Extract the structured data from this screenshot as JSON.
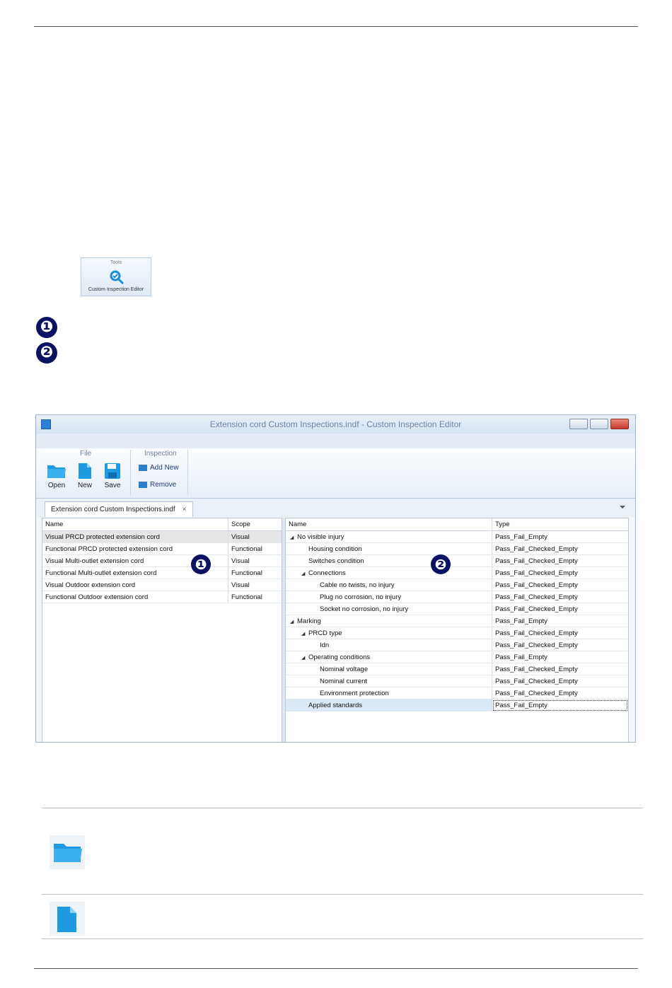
{
  "tools_button": {
    "group_label": "Tools",
    "label": "Custom Inspection Editor"
  },
  "markers": [
    "❶",
    "❷"
  ],
  "window": {
    "title": "Extension cord Custom Inspections.indf - Custom Inspection Editor",
    "ribbon": {
      "file_group": "File",
      "inspection_group": "Inspection",
      "open": "Open",
      "new": "New",
      "save": "Save",
      "add_new": "Add New",
      "remove": "Remove"
    },
    "doc_tab": "Extension cord Custom Inspections.indf",
    "doc_tab_close": "×"
  },
  "left_table": {
    "headers": [
      "Name",
      "Scope"
    ],
    "rows": [
      {
        "name": "Visual PRCD protected extension cord",
        "scope": "Visual"
      },
      {
        "name": "Functional PRCD protected extension cord",
        "scope": "Functional"
      },
      {
        "name": "Visual Multi-outlet extension cord",
        "scope": "Visual"
      },
      {
        "name": "Functional Multi-outlet extension cord",
        "scope": "Functional"
      },
      {
        "name": "Visual Outdoor extension cord",
        "scope": "Visual"
      },
      {
        "name": "Functional Outdoor extension cord",
        "scope": "Functional"
      }
    ]
  },
  "right_table": {
    "headers": [
      "Name",
      "Type"
    ],
    "rows": [
      {
        "name": "No visible injury",
        "type": "Pass_Fail_Empty",
        "level": 0,
        "expander": "◢"
      },
      {
        "name": "Housing condition",
        "type": "Pass_Fail_Checked_Empty",
        "level": 1,
        "expander": ""
      },
      {
        "name": "Switches condition",
        "type": "Pass_Fail_Checked_Empty",
        "level": 1,
        "expander": ""
      },
      {
        "name": "Connections",
        "type": "Pass_Fail_Checked_Empty",
        "level": 1,
        "expander": "◢"
      },
      {
        "name": "Cable no twists, no injury",
        "type": "Pass_Fail_Checked_Empty",
        "level": 2,
        "expander": ""
      },
      {
        "name": "Plug no corrosion, no injury",
        "type": "Pass_Fail_Checked_Empty",
        "level": 2,
        "expander": ""
      },
      {
        "name": "Socket no corrosion, no injury",
        "type": "Pass_Fail_Checked_Empty",
        "level": 2,
        "expander": ""
      },
      {
        "name": "Marking",
        "type": "Pass_Fail_Empty",
        "level": 0,
        "expander": "◢"
      },
      {
        "name": "PRCD type",
        "type": "Pass_Fail_Checked_Empty",
        "level": 1,
        "expander": "◢"
      },
      {
        "name": "Idn",
        "type": "Pass_Fail_Checked_Empty",
        "level": 2,
        "expander": ""
      },
      {
        "name": "Operating conditions",
        "type": "Pass_Fail_Empty",
        "level": 1,
        "expander": "◢"
      },
      {
        "name": "Nominal voltage",
        "type": "Pass_Fail_Checked_Empty",
        "level": 2,
        "expander": ""
      },
      {
        "name": "Nominal current",
        "type": "Pass_Fail_Checked_Empty",
        "level": 2,
        "expander": ""
      },
      {
        "name": "Environment protection",
        "type": "Pass_Fail_Checked_Empty",
        "level": 2,
        "expander": ""
      },
      {
        "name": "Applied standards",
        "type": "Pass_Fail_Empty",
        "level": 1,
        "expander": ""
      }
    ]
  },
  "icons": {
    "open": "folder-icon",
    "new": "new-file-icon",
    "save": "floppy-disk-icon"
  },
  "colors": {
    "accent": "#1ea0e6",
    "marker": "#0b1262",
    "selection": "#dbe9f6"
  }
}
